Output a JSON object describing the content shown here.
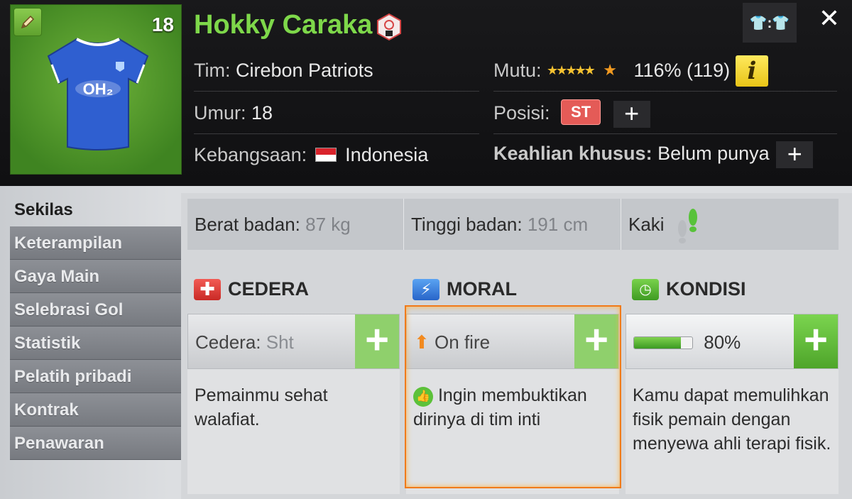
{
  "player": {
    "name": "Hokky Caraka",
    "number": "18",
    "team_label": "Tim:",
    "team": "Cirebon Patriots",
    "age_label": "Umur:",
    "age": "18",
    "nationality_label": "Kebangsaan:",
    "nationality": "Indonesia",
    "quality_label": "Mutu:",
    "quality_stars": "★★★★★",
    "quality_extra_star": "★",
    "quality_value": "116% (119)",
    "position_label": "Posisi:",
    "position": "ST",
    "special_skill_label": "Keahlian khusus:",
    "special_skill": "Belum punya"
  },
  "header": {
    "kit_icon_text": "👕:👕",
    "close_icon": "✕",
    "info_icon": "i",
    "plus_icon": "+"
  },
  "nav": {
    "items": [
      {
        "label": "Sekilas"
      },
      {
        "label": "Keterampilan"
      },
      {
        "label": "Gaya Main"
      },
      {
        "label": "Selebrasi Gol"
      },
      {
        "label": "Statistik"
      },
      {
        "label": "Pelatih pribadi"
      },
      {
        "label": "Kontrak"
      },
      {
        "label": "Penawaran"
      }
    ]
  },
  "stats": {
    "weight_label": "Berat badan:",
    "weight": "87 kg",
    "height_label": "Tinggi badan:",
    "height": "191 cm",
    "foot_label": "Kaki"
  },
  "sections": {
    "injury": {
      "title": "CEDERA",
      "status_label": "Cedera:",
      "status": "Sht",
      "description": "Pemainmu sehat walafiat."
    },
    "morale": {
      "title": "MORAL",
      "status": "On fire",
      "description": "Ingin membuktikan dirinya di tim inti"
    },
    "condition": {
      "title": "KONDISI",
      "percent_text": "80%",
      "level": 0.8,
      "description": "Kamu dapat memulihkan fisik pemain dengan menyewa ahli terapi fisik."
    }
  },
  "colors": {
    "name_green": "#7ed84a",
    "accent_green": "#5cb533",
    "position_red": "#e45b57",
    "morale_orange": "#f07a1a"
  }
}
